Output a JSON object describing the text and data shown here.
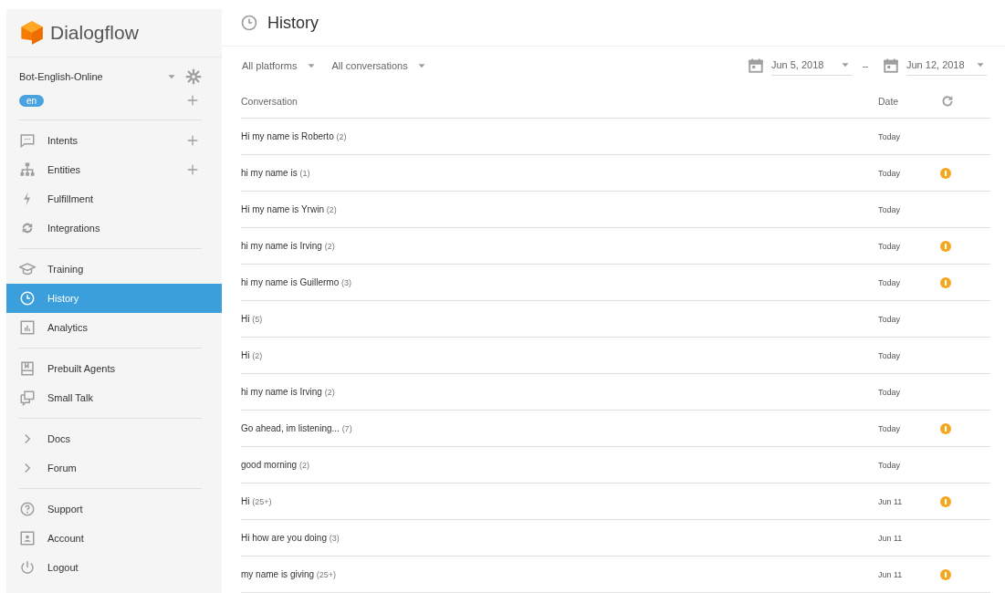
{
  "sidebar": {
    "logo": "Dialogflow",
    "agent": {
      "name": "Bot-English-Online",
      "language": "en"
    },
    "groups": [
      [
        {
          "label": "Intents",
          "kind": "chat",
          "addable": true,
          "selected": false
        },
        {
          "label": "Entities",
          "kind": "tree",
          "addable": true,
          "selected": false
        },
        {
          "label": "Fulfillment",
          "kind": "bolt",
          "addable": false,
          "selected": false
        },
        {
          "label": "Integrations",
          "kind": "sync",
          "addable": false,
          "selected": false
        }
      ],
      [
        {
          "label": "Training",
          "kind": "cap",
          "addable": false,
          "selected": false
        },
        {
          "label": "History",
          "kind": "clock",
          "addable": false,
          "selected": true
        },
        {
          "label": "Analytics",
          "kind": "chart",
          "addable": false,
          "selected": false
        }
      ],
      [
        {
          "label": "Prebuilt Agents",
          "kind": "book",
          "addable": false,
          "selected": false
        },
        {
          "label": "Small Talk",
          "kind": "bubbles",
          "addable": false,
          "selected": false
        }
      ],
      [
        {
          "label": "Docs",
          "kind": "chevron",
          "addable": false,
          "selected": false
        },
        {
          "label": "Forum",
          "kind": "chevron",
          "addable": false,
          "selected": false
        }
      ],
      [
        {
          "label": "Support",
          "kind": "help",
          "addable": false,
          "selected": false
        },
        {
          "label": "Account",
          "kind": "account",
          "addable": false,
          "selected": false
        },
        {
          "label": "Logout",
          "kind": "power",
          "addable": false,
          "selected": false
        }
      ]
    ]
  },
  "header": {
    "title": "History"
  },
  "filters": {
    "platform": "All platforms",
    "conversations": "All conversations",
    "date_from": "Jun 5, 2018",
    "separator": "–",
    "date_to": "Jun 12, 2018"
  },
  "table": {
    "columns": [
      "Conversation",
      "Date"
    ],
    "rows": [
      {
        "text": "Hi my name is Roberto",
        "count": "(2)",
        "date": "Today",
        "flagged": false
      },
      {
        "text": "hi my name is",
        "count": "(1)",
        "date": "Today",
        "flagged": true
      },
      {
        "text": "Hi my name is Yrwin",
        "count": "(2)",
        "date": "Today",
        "flagged": false
      },
      {
        "text": "hi my name is Irving",
        "count": "(2)",
        "date": "Today",
        "flagged": true
      },
      {
        "text": "hi my name is Guillermo",
        "count": "(3)",
        "date": "Today",
        "flagged": true
      },
      {
        "text": "Hi",
        "count": "(5)",
        "date": "Today",
        "flagged": false
      },
      {
        "text": "Hi",
        "count": "(2)",
        "date": "Today",
        "flagged": false
      },
      {
        "text": "hi my name is Irving",
        "count": "(2)",
        "date": "Today",
        "flagged": false
      },
      {
        "text": "Go ahead, im listening...",
        "count": "(7)",
        "date": "Today",
        "flagged": true
      },
      {
        "text": "good morning",
        "count": "(2)",
        "date": "Today",
        "flagged": false
      },
      {
        "text": "Hi",
        "count": "(25+)",
        "date": "Jun 11",
        "flagged": true
      },
      {
        "text": "Hi how are you doing",
        "count": "(3)",
        "date": "Jun 11",
        "flagged": false
      },
      {
        "text": "my name is giving",
        "count": "(25+)",
        "date": "Jun 11",
        "flagged": true
      }
    ]
  }
}
